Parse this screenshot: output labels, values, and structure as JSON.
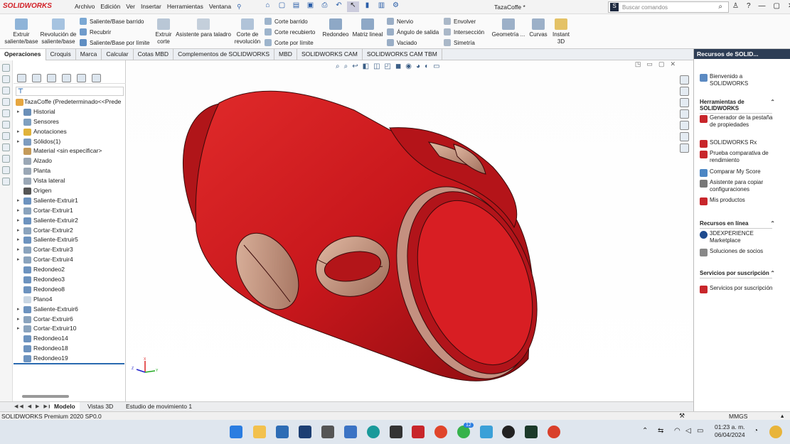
{
  "title_bar": {
    "logo": "SOLIDWORKS",
    "menus": [
      "Archivo",
      "Edición",
      "Ver",
      "Insertar",
      "Herramientas",
      "Ventana"
    ],
    "window_title": "TazaCoffe *",
    "search_placeholder": "Buscar comandos"
  },
  "ribbon": {
    "extruir_base": "Extruir saliente/base",
    "revolucion_base": "Revolución de saliente/base",
    "barrido_base": "Saliente/Base barrido",
    "recubrir": "Recubrir",
    "limite_base": "Saliente/Base por límite",
    "extruir_corte": "Extruir corte",
    "asistente": "Asistente para taladro",
    "corte_revolucion": "Corte de revolución",
    "corte_barrido": "Corte barrido",
    "corte_recubierto": "Corte recubierto",
    "corte_limite": "Corte por límite",
    "redondeo": "Redondeo",
    "matriz_lineal": "Matriz lineal",
    "nervio": "Nervio",
    "angulo_salida": "Ángulo de salida",
    "vaciado": "Vaciado",
    "envolver": "Envolver",
    "interseccion": "Intersección",
    "simetria": "Simetría",
    "geometria": "Geometría ...",
    "curvas": "Curvas",
    "instant3d": "Instant 3D"
  },
  "tabs": [
    "Operaciones",
    "Croquis",
    "Marca",
    "Calcular",
    "Cotas MBD",
    "Complementos de SOLIDWORKS",
    "MBD",
    "SOLIDWORKS CAM",
    "SOLIDWORKS CAM TBM"
  ],
  "feature_tree": {
    "root": "TazaCoffe  (Predeterminado<<Prede",
    "items": [
      {
        "label": "Historial",
        "expand": true
      },
      {
        "label": "Sensores",
        "expand": false
      },
      {
        "label": "Anotaciones",
        "expand": true
      },
      {
        "label": "Sólidos(1)",
        "expand": true
      },
      {
        "label": "Material <sin especificar>",
        "expand": false
      },
      {
        "label": "Alzado",
        "expand": false
      },
      {
        "label": "Planta",
        "expand": false
      },
      {
        "label": "Vista lateral",
        "expand": false
      },
      {
        "label": "Origen",
        "expand": false
      },
      {
        "label": "Saliente-Extruir1",
        "expand": true
      },
      {
        "label": "Cortar-Extruir1",
        "expand": true
      },
      {
        "label": "Saliente-Extruir2",
        "expand": true
      },
      {
        "label": "Cortar-Extruir2",
        "expand": true
      },
      {
        "label": "Saliente-Extruir5",
        "expand": true
      },
      {
        "label": "Cortar-Extruir3",
        "expand": true
      },
      {
        "label": "Cortar-Extruir4",
        "expand": true
      },
      {
        "label": "Redondeo2",
        "expand": false
      },
      {
        "label": "Redondeo3",
        "expand": false
      },
      {
        "label": "Redondeo8",
        "expand": false
      },
      {
        "label": "Plano4",
        "expand": false
      },
      {
        "label": "Saliente-Extruir6",
        "expand": true
      },
      {
        "label": "Cortar-Extruir6",
        "expand": true
      },
      {
        "label": "Cortar-Extruir10",
        "expand": true
      },
      {
        "label": "Redondeo14",
        "expand": false
      },
      {
        "label": "Redondeo18",
        "expand": false
      },
      {
        "label": "Redondeo19",
        "expand": false
      }
    ]
  },
  "task_pane": {
    "header": "Recursos de SOLID...",
    "welcome": "Bienvenido a SOLIDWORKS",
    "tools_header": "Herramientas de SOLIDWORKS",
    "tools": [
      "Generador de la pestaña de propiedades",
      "SOLIDWORKS Rx",
      "Prueba comparativa de rendimiento",
      "Comparar My Score",
      "Asistente para copiar configuraciones",
      "Mis productos"
    ],
    "online_header": "Recursos en línea",
    "online": [
      "3DEXPERIENCE Marketplace",
      "Soluciones de socios"
    ],
    "sub_header": "Servicios por suscripción",
    "sub": [
      "Servicios por suscripción"
    ]
  },
  "bottom_tabs": [
    "Modelo",
    "Vistas 3D",
    "Estudio de movimiento 1"
  ],
  "status": {
    "left": "SOLIDWORKS Premium 2020 SP0.0",
    "units": "MMGS"
  },
  "taskbar": {
    "time": "01:23 a. m.",
    "date": "06/04/2024",
    "badge": "12"
  },
  "colors": {
    "model_red": "#c8171c",
    "model_tan": "#c6907a",
    "accent": "#2a6ab0"
  }
}
